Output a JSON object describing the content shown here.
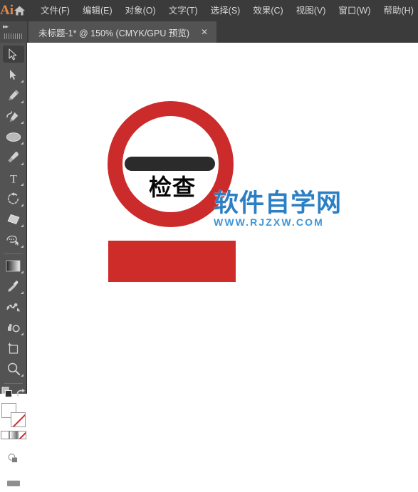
{
  "app": {
    "name": "Ai",
    "logo_color": "#e08a4c",
    "chrome_bg": "#3b3b3b",
    "panel_bg": "#535353"
  },
  "menubar": {
    "home_icon": "home-icon",
    "items": [
      {
        "label": "文件(F)",
        "name": "menu-file"
      },
      {
        "label": "编辑(E)",
        "name": "menu-edit"
      },
      {
        "label": "对象(O)",
        "name": "menu-object"
      },
      {
        "label": "文字(T)",
        "name": "menu-type"
      },
      {
        "label": "选择(S)",
        "name": "menu-select"
      },
      {
        "label": "效果(C)",
        "name": "menu-effect"
      },
      {
        "label": "视图(V)",
        "name": "menu-view"
      },
      {
        "label": "窗口(W)",
        "name": "menu-window"
      },
      {
        "label": "帮助(H)",
        "name": "menu-help"
      }
    ]
  },
  "tabbar": {
    "expand_icon": "double-chevron-right-icon",
    "grip_icon": "panel-grip-icon",
    "document_tab": {
      "title": "未标题-1* @ 150% (CMYK/GPU 预览)",
      "close_label": "✕"
    }
  },
  "toolpanel": {
    "tools": [
      {
        "name": "selection-tool",
        "icon": "arrow-outline-icon",
        "selected": true,
        "has_flyout": false
      },
      {
        "name": "direct-selection-tool",
        "icon": "arrow-solid-icon",
        "selected": false,
        "has_flyout": true
      },
      {
        "name": "pen-tool",
        "icon": "pen-icon",
        "selected": false,
        "has_flyout": true
      },
      {
        "name": "curvature-tool",
        "icon": "curvature-icon",
        "selected": false,
        "has_flyout": true
      },
      {
        "name": "ellipse-tool",
        "icon": "ellipse-icon",
        "selected": false,
        "has_flyout": true
      },
      {
        "name": "paintbrush-tool",
        "icon": "paintbrush-icon",
        "selected": false,
        "has_flyout": true
      },
      {
        "name": "type-tool",
        "icon": "type-t-icon",
        "selected": false,
        "has_flyout": true
      },
      {
        "name": "rotate-tool",
        "icon": "rotate-icon",
        "selected": false,
        "has_flyout": true
      },
      {
        "name": "eraser-tool",
        "icon": "eraser-icon",
        "selected": false,
        "has_flyout": true
      },
      {
        "name": "shape-builder-tool",
        "icon": "shape-builder-icon",
        "selected": false,
        "has_flyout": true
      },
      {
        "name": "gradient-tool",
        "icon": "gradient-icon",
        "selected": false,
        "has_flyout": true
      },
      {
        "name": "eyedropper-tool",
        "icon": "eyedropper-icon",
        "selected": false,
        "has_flyout": true
      },
      {
        "name": "blend-tool",
        "icon": "blend-icon",
        "selected": false,
        "has_flyout": false
      },
      {
        "name": "symbol-sprayer-tool",
        "icon": "symbol-sprayer-icon",
        "selected": false,
        "has_flyout": true
      },
      {
        "name": "artboard-tool",
        "icon": "artboard-icon",
        "selected": false,
        "has_flyout": false
      },
      {
        "name": "zoom-tool",
        "icon": "magnifier-icon",
        "selected": false,
        "has_flyout": true
      }
    ],
    "mode_row": [
      {
        "name": "change-screen-mode-button",
        "icon": "overlapping-squares-icon"
      },
      {
        "name": "swap-fill-stroke-button",
        "icon": "swap-arrow-icon"
      }
    ],
    "fill_color": "#ffffff",
    "stroke_color": "#ffffff",
    "none_indicator_color": "#d5252a",
    "mini_swatches": [
      {
        "name": "color-swatch-button",
        "icon": "solid-color-icon"
      },
      {
        "name": "gradient-swatch-button",
        "icon": "gradient-swatch-icon"
      },
      {
        "name": "none-swatch-button",
        "icon": "none-swatch-icon"
      }
    ],
    "bottom": [
      {
        "name": "drawing-modes-button",
        "icon": "draw-normal-icon"
      },
      {
        "name": "screen-mode-button",
        "icon": "screen-mode-icon"
      }
    ]
  },
  "canvas": {
    "background": "#ffffff",
    "artwork": {
      "sign": {
        "name": "circular-sign-graphic",
        "ring_color": "#cc2b2b",
        "bar_color": "#2b2b2b",
        "text": "检查",
        "text_color": "#050505"
      },
      "rectangle": {
        "name": "red-rectangle-shape",
        "fill": "#cd2c29"
      }
    },
    "watermark": {
      "name": "site-watermark",
      "main_text": "软件自学网",
      "sub_text": "WWW.RJZXW.COM",
      "main_color": "#2b7fc4",
      "sub_color": "#3d95d8"
    }
  }
}
